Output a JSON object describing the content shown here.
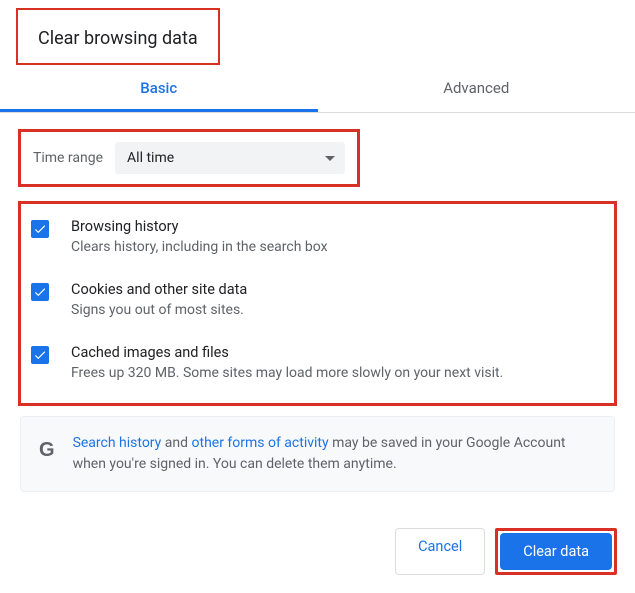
{
  "title": "Clear browsing data",
  "tabs": {
    "basic": "Basic",
    "advanced": "Advanced"
  },
  "timerange": {
    "label": "Time range",
    "value": "All time"
  },
  "options": [
    {
      "title": "Browsing history",
      "desc": "Clears history, including in the search box"
    },
    {
      "title": "Cookies and other site data",
      "desc": "Signs you out of most sites."
    },
    {
      "title": "Cached images and files",
      "desc": "Frees up 320 MB. Some sites may load more slowly on your next visit."
    }
  ],
  "info": {
    "link1": "Search history",
    "mid": " and ",
    "link2": "other forms of activity",
    "rest": " may be saved in your Google Account when you're signed in. You can delete them anytime."
  },
  "buttons": {
    "cancel": "Cancel",
    "clear": "Clear data"
  }
}
